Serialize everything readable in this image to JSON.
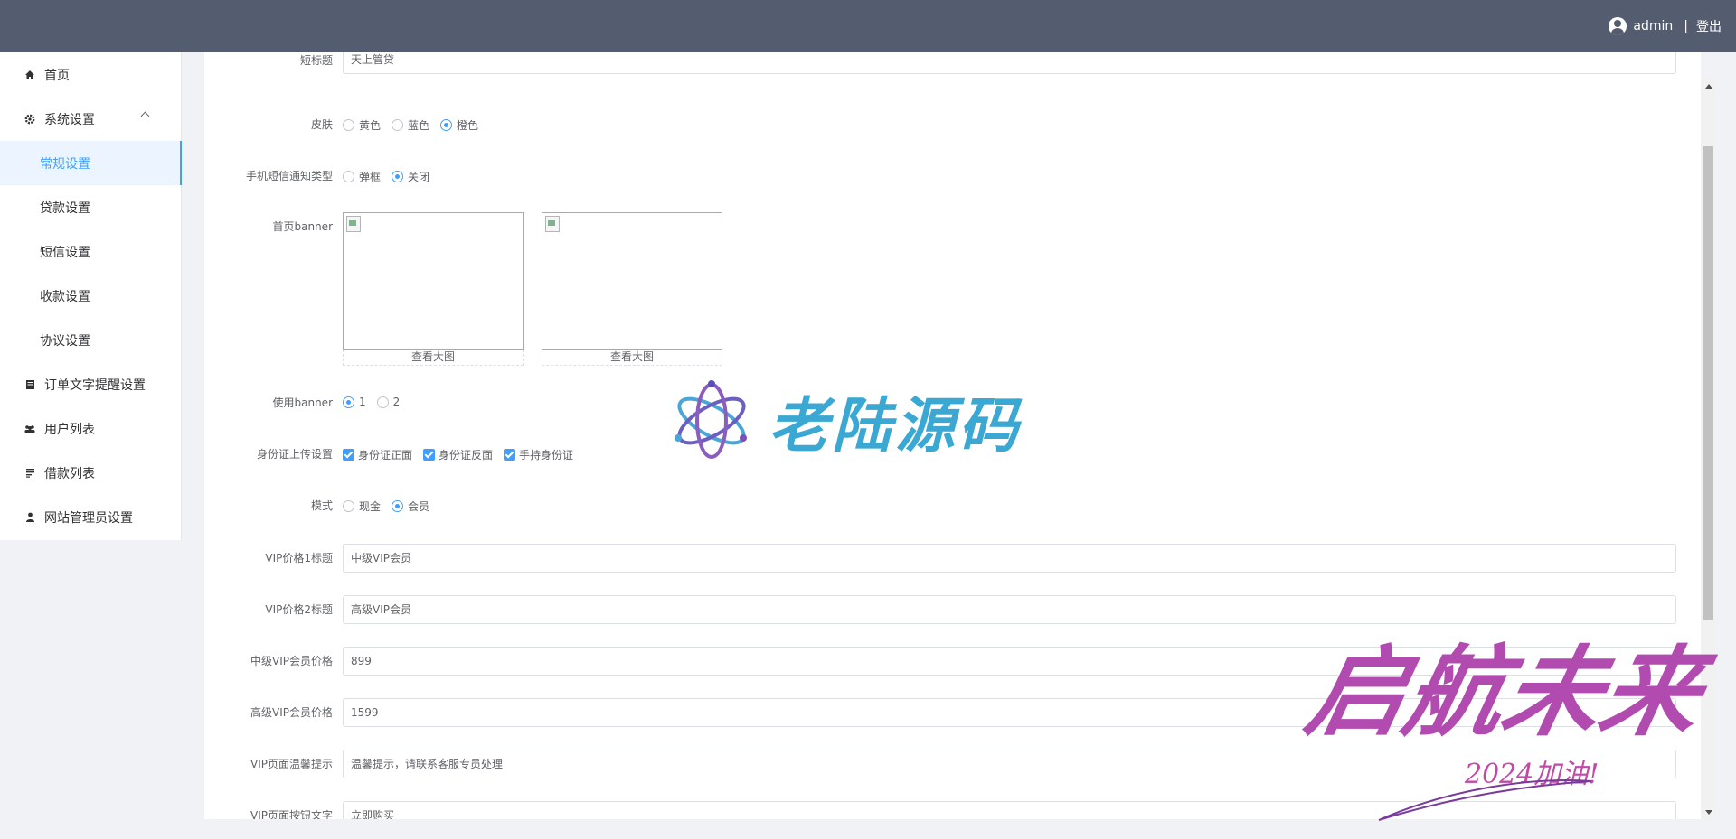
{
  "header": {
    "username": "admin",
    "separator": "|",
    "logout": "登出"
  },
  "sidebar": {
    "home": "首页",
    "system_settings": "系统设置",
    "sub": [
      "常规设置",
      "贷款设置",
      "短信设置",
      "收款设置",
      "协议设置"
    ],
    "order_text": "订单文字提醒设置",
    "users": "用户列表",
    "loans": "借款列表",
    "admins": "网站管理员设置"
  },
  "form": {
    "top_input": {
      "label": "短标题",
      "value": "天上管贷"
    },
    "skin": {
      "label": "皮肤",
      "options": [
        "黄色",
        "蓝色",
        "橙色"
      ],
      "selected": "橙色"
    },
    "sms": {
      "label": "手机短信通知类型",
      "options": [
        "弹框",
        "关闭"
      ],
      "selected": "关闭"
    },
    "banner": {
      "label": "首页banner",
      "view1": "查看大图",
      "view2": "查看大图"
    },
    "use_banner": {
      "label": "使用banner",
      "options": [
        "1",
        "2"
      ],
      "selected": "1"
    },
    "idcard": {
      "label": "身份证上传设置",
      "options": [
        "身份证正面",
        "身份证反面",
        "手持身份证"
      ]
    },
    "mode": {
      "label": "模式",
      "options": [
        "现金",
        "会员"
      ],
      "selected": "会员"
    },
    "vip1_title": {
      "label": "VIP价格1标题",
      "value": "中级VIP会员"
    },
    "vip2_title": {
      "label": "VIP价格2标题",
      "value": "高级VIP会员"
    },
    "vip_mid_price": {
      "label": "中级VIP会员价格",
      "value": "899"
    },
    "vip_high_price": {
      "label": "高级VIP会员价格",
      "value": "1599"
    },
    "vip_tip": {
      "label": "VIP页面温馨提示",
      "value": "温馨提示，请联系客服专员处理"
    },
    "vip_btn": {
      "label": "VIP页面按钮文字",
      "value": "立即购买"
    }
  },
  "watermark": {
    "logo_text": "老陆源码",
    "sign_text": "启航未来",
    "sign_sub": "2024加油!"
  },
  "colors": {
    "header": "#545c70",
    "accent": "#409eff",
    "logo": "#3ba8d3",
    "sign": "#b24bb0"
  }
}
